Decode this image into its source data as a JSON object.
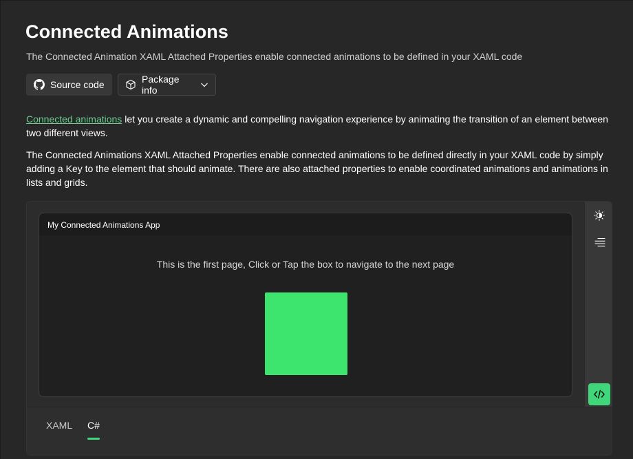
{
  "page": {
    "title": "Connected Animations",
    "subtitle": "The Connected Animation XAML Attached Properties enable connected animations to be defined in your XAML code"
  },
  "buttons": {
    "source_code": "Source code",
    "package_info": "Package info"
  },
  "description": {
    "link_text": "Connected animations",
    "paragraph1_rest": " let you create a dynamic and compelling navigation experience by animating the transition of an element between two different views.",
    "paragraph2": "The Connected Animations XAML Attached Properties enable connected animations to be defined directly in your XAML code by simply adding a Key to the element that should animate. There are also attached properties to enable coordinated animations and animations in lists and grids."
  },
  "sample": {
    "app_title": "My Connected Animations App",
    "app_text": "This is the first page, Click or Tap the box to navigate to the next page",
    "box_color": "#3de56e",
    "tabs": [
      {
        "label": "XAML",
        "selected": false
      },
      {
        "label": "C#",
        "selected": true
      }
    ]
  },
  "icons": {
    "source": "github-icon",
    "package": "package-icon",
    "dropdown": "chevron-down-icon",
    "theme": "theme-toggle-icon",
    "options": "options-menu-icon",
    "code": "code-icon"
  },
  "colors": {
    "accent": "#3fd77a",
    "link": "#6ccb8f",
    "background": "#272727"
  }
}
